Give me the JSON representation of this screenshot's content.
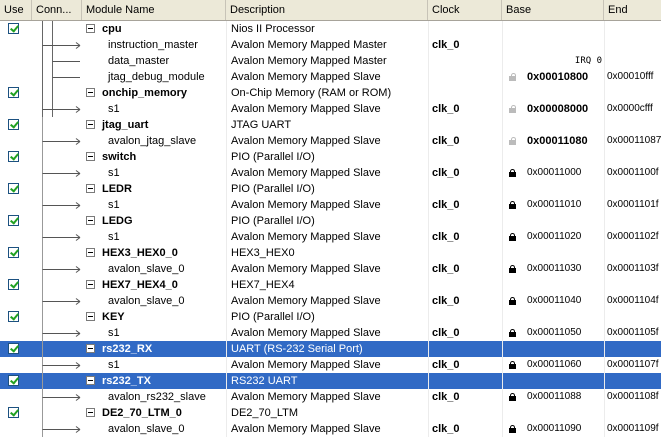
{
  "columns": {
    "use": "Use",
    "connections": "Conn...",
    "module_name": "Module Name",
    "description": "Description",
    "clock": "Clock",
    "base": "Base",
    "end": "End"
  },
  "rows": [
    {
      "kind": "module",
      "name": "cpu",
      "description": "Nios II Processor",
      "clock": "",
      "base": "",
      "end": "",
      "lock": "",
      "checked": true,
      "selected": false
    },
    {
      "kind": "port",
      "name": "instruction_master",
      "description": "Avalon Memory Mapped Master",
      "clock": "clk_0",
      "base": "",
      "end": "",
      "lock": "",
      "irq": ""
    },
    {
      "kind": "port",
      "name": "data_master",
      "description": "Avalon Memory Mapped Master",
      "clock": "",
      "base": "",
      "end": "",
      "lock": "",
      "irq": "IRQ 0"
    },
    {
      "kind": "port",
      "name": "jtag_debug_module",
      "description": "Avalon Memory Mapped Slave",
      "clock": "",
      "base": "0x00010800",
      "end": "0x00010fff",
      "lock": "open",
      "irq": ""
    },
    {
      "kind": "module",
      "name": "onchip_memory",
      "description": "On-Chip Memory (RAM or ROM)",
      "clock": "",
      "base": "",
      "end": "",
      "lock": "",
      "checked": true,
      "selected": false
    },
    {
      "kind": "port",
      "name": "s1",
      "description": "Avalon Memory Mapped Slave",
      "clock": "clk_0",
      "base": "0x00008000",
      "end": "0x0000cfff",
      "lock": "open",
      "irq": ""
    },
    {
      "kind": "module",
      "name": "jtag_uart",
      "description": "JTAG UART",
      "clock": "",
      "base": "",
      "end": "",
      "lock": "",
      "checked": true,
      "selected": false
    },
    {
      "kind": "port",
      "name": "avalon_jtag_slave",
      "description": "Avalon Memory Mapped Slave",
      "clock": "clk_0",
      "base": "0x00011080",
      "end": "0x00011087",
      "lock": "open",
      "irq": ""
    },
    {
      "kind": "module",
      "name": "switch",
      "description": "PIO (Parallel I/O)",
      "clock": "",
      "base": "",
      "end": "",
      "lock": "",
      "checked": true,
      "selected": false
    },
    {
      "kind": "port",
      "name": "s1",
      "description": "Avalon Memory Mapped Slave",
      "clock": "clk_0",
      "base": "0x00011000",
      "end": "0x0001100f",
      "lock": "closed",
      "irq": ""
    },
    {
      "kind": "module",
      "name": "LEDR",
      "description": "PIO (Parallel I/O)",
      "clock": "",
      "base": "",
      "end": "",
      "lock": "",
      "checked": true,
      "selected": false
    },
    {
      "kind": "port",
      "name": "s1",
      "description": "Avalon Memory Mapped Slave",
      "clock": "clk_0",
      "base": "0x00011010",
      "end": "0x0001101f",
      "lock": "closed",
      "irq": ""
    },
    {
      "kind": "module",
      "name": "LEDG",
      "description": "PIO (Parallel I/O)",
      "clock": "",
      "base": "",
      "end": "",
      "lock": "",
      "checked": true,
      "selected": false
    },
    {
      "kind": "port",
      "name": "s1",
      "description": "Avalon Memory Mapped Slave",
      "clock": "clk_0",
      "base": "0x00011020",
      "end": "0x0001102f",
      "lock": "closed",
      "irq": ""
    },
    {
      "kind": "module",
      "name": "HEX3_HEX0_0",
      "description": "HEX3_HEX0",
      "clock": "",
      "base": "",
      "end": "",
      "lock": "",
      "checked": true,
      "selected": false
    },
    {
      "kind": "port",
      "name": "avalon_slave_0",
      "description": "Avalon Memory Mapped Slave",
      "clock": "clk_0",
      "base": "0x00011030",
      "end": "0x0001103f",
      "lock": "closed",
      "irq": ""
    },
    {
      "kind": "module",
      "name": "HEX7_HEX4_0",
      "description": "HEX7_HEX4",
      "clock": "",
      "base": "",
      "end": "",
      "lock": "",
      "checked": true,
      "selected": false
    },
    {
      "kind": "port",
      "name": "avalon_slave_0",
      "description": "Avalon Memory Mapped Slave",
      "clock": "clk_0",
      "base": "0x00011040",
      "end": "0x0001104f",
      "lock": "closed",
      "irq": ""
    },
    {
      "kind": "module",
      "name": "KEY",
      "description": "PIO (Parallel I/O)",
      "clock": "",
      "base": "",
      "end": "",
      "lock": "",
      "checked": true,
      "selected": false
    },
    {
      "kind": "port",
      "name": "s1",
      "description": "Avalon Memory Mapped Slave",
      "clock": "clk_0",
      "base": "0x00011050",
      "end": "0x0001105f",
      "lock": "closed",
      "irq": ""
    },
    {
      "kind": "module",
      "name": "rs232_RX",
      "description": "UART (RS-232 Serial Port)",
      "clock": "",
      "base": "",
      "end": "",
      "lock": "",
      "checked": true,
      "selected": true
    },
    {
      "kind": "port",
      "name": "s1",
      "description": "Avalon Memory Mapped Slave",
      "clock": "clk_0",
      "base": "0x00011060",
      "end": "0x0001107f",
      "lock": "closed",
      "irq": ""
    },
    {
      "kind": "module",
      "name": "rs232_TX",
      "description": "RS232 UART",
      "clock": "",
      "base": "",
      "end": "",
      "lock": "",
      "checked": true,
      "selected": true
    },
    {
      "kind": "port",
      "name": "avalon_rs232_slave",
      "description": "Avalon Memory Mapped Slave",
      "clock": "clk_0",
      "base": "0x00011088",
      "end": "0x0001108f",
      "lock": "closed",
      "irq": ""
    },
    {
      "kind": "module",
      "name": "DE2_70_LTM_0",
      "description": "DE2_70_LTM",
      "clock": "",
      "base": "",
      "end": "",
      "lock": "",
      "checked": true,
      "selected": false
    },
    {
      "kind": "port",
      "name": "avalon_slave_0",
      "description": "Avalon Memory Mapped Slave",
      "clock": "clk_0",
      "base": "0x00011090",
      "end": "0x0001109f",
      "lock": "closed",
      "irq": ""
    }
  ],
  "colors": {
    "selection": "#316ac5",
    "header": "#ece9d8",
    "checkbox_border": "#1c5180",
    "checkmark": "#21a121"
  }
}
